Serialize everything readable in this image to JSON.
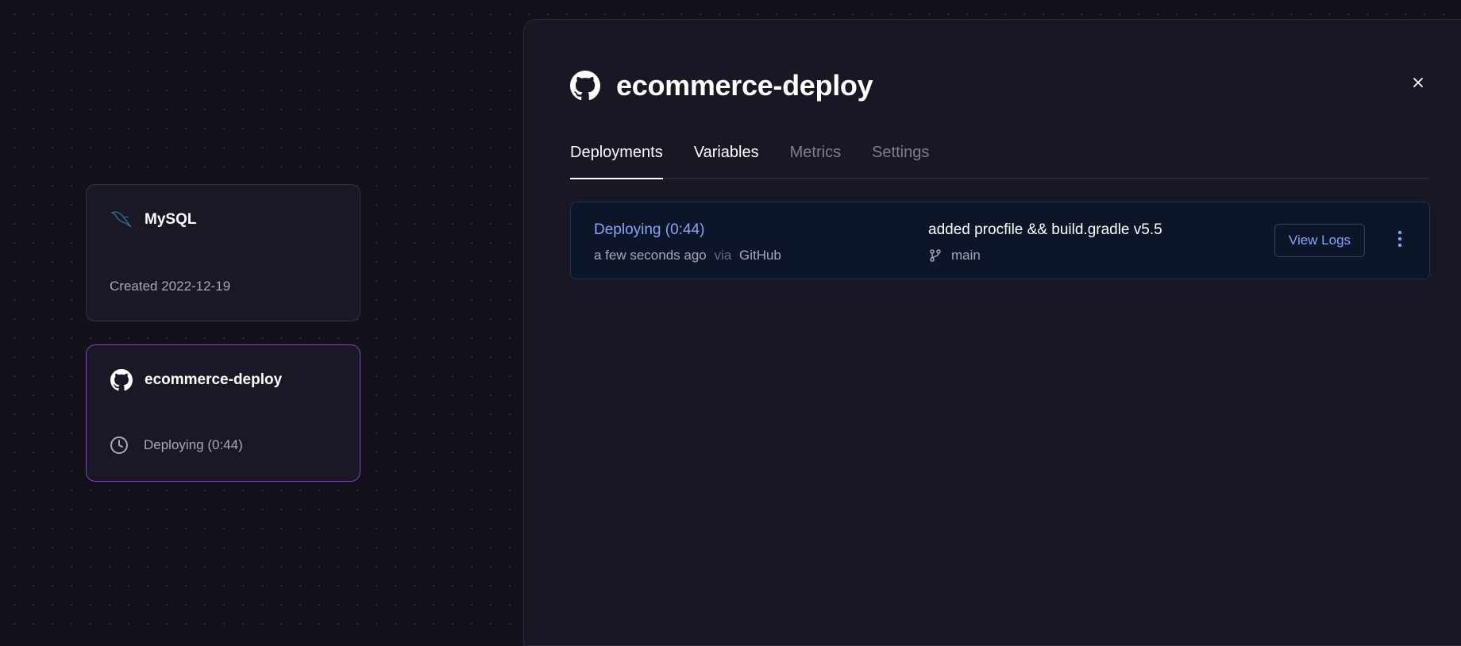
{
  "canvas": {
    "services": [
      {
        "name": "MySQL",
        "icon": "mysql-dolphin-icon",
        "footer": "Created 2022-12-19"
      },
      {
        "name": "ecommerce-deploy",
        "icon": "github-icon",
        "footer_icon": "clock-icon",
        "footer": "Deploying (0:44)"
      }
    ]
  },
  "panel": {
    "title": "ecommerce-deploy",
    "title_icon": "github-icon",
    "close_icon": "close-icon",
    "tabs": [
      {
        "label": "Deployments",
        "state": "active"
      },
      {
        "label": "Variables",
        "state": "normal"
      },
      {
        "label": "Metrics",
        "state": "dim"
      },
      {
        "label": "Settings",
        "state": "dim"
      }
    ],
    "deployment": {
      "status": "Deploying (0:44)",
      "time": "a few seconds ago",
      "via_word": "via",
      "source": "GitHub",
      "commit_message": "added procfile && build.gradle v5.5",
      "branch_icon": "git-branch-icon",
      "branch": "main",
      "view_logs_label": "View Logs",
      "more_icon": "more-vertical-icon"
    }
  },
  "colors": {
    "accent_purple": "#7e3fc9",
    "status_blue": "#8aa4f5",
    "background": "#13111c"
  }
}
